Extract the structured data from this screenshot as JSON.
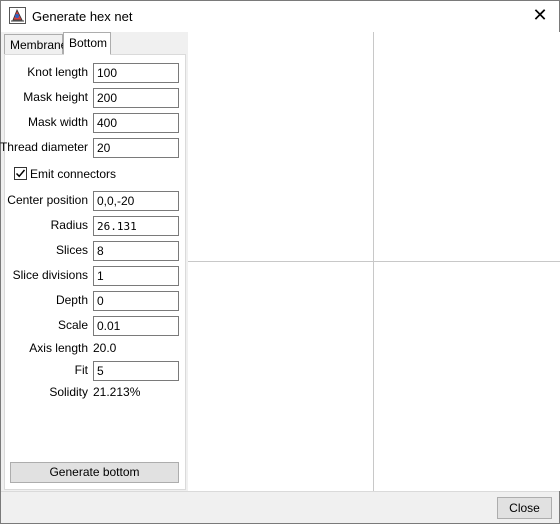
{
  "window": {
    "title": "Generate hex net",
    "close_glyph": "✕"
  },
  "tabs": [
    {
      "label": "Membrane",
      "active": false
    },
    {
      "label": "Bottom",
      "active": true
    }
  ],
  "form": {
    "knot_length": {
      "label": "Knot length",
      "value": "100"
    },
    "mask_height": {
      "label": "Mask height",
      "value": "200"
    },
    "mask_width": {
      "label": "Mask width",
      "value": "400"
    },
    "thread_diameter": {
      "label": "Thread diameter",
      "value": "20"
    },
    "emit_connectors": {
      "label": "Emit connectors",
      "checked": true
    },
    "center_position": {
      "label": "Center position",
      "value": "0,0,-20"
    },
    "radius": {
      "label": "Radius",
      "value": "26.131"
    },
    "slices": {
      "label": "Slices",
      "value": "8"
    },
    "slice_divisions": {
      "label": "Slice divisions",
      "value": "1"
    },
    "depth": {
      "label": "Depth",
      "value": "0"
    },
    "scale": {
      "label": "Scale",
      "value": "0.01"
    },
    "axis_length": {
      "label": "Axis length",
      "value": "20.0"
    },
    "fit": {
      "label": "Fit",
      "value": "5"
    },
    "solidity": {
      "label": "Solidity",
      "value": "21.213%"
    }
  },
  "buttons": {
    "generate_bottom": "Generate bottom",
    "close": "Close"
  }
}
